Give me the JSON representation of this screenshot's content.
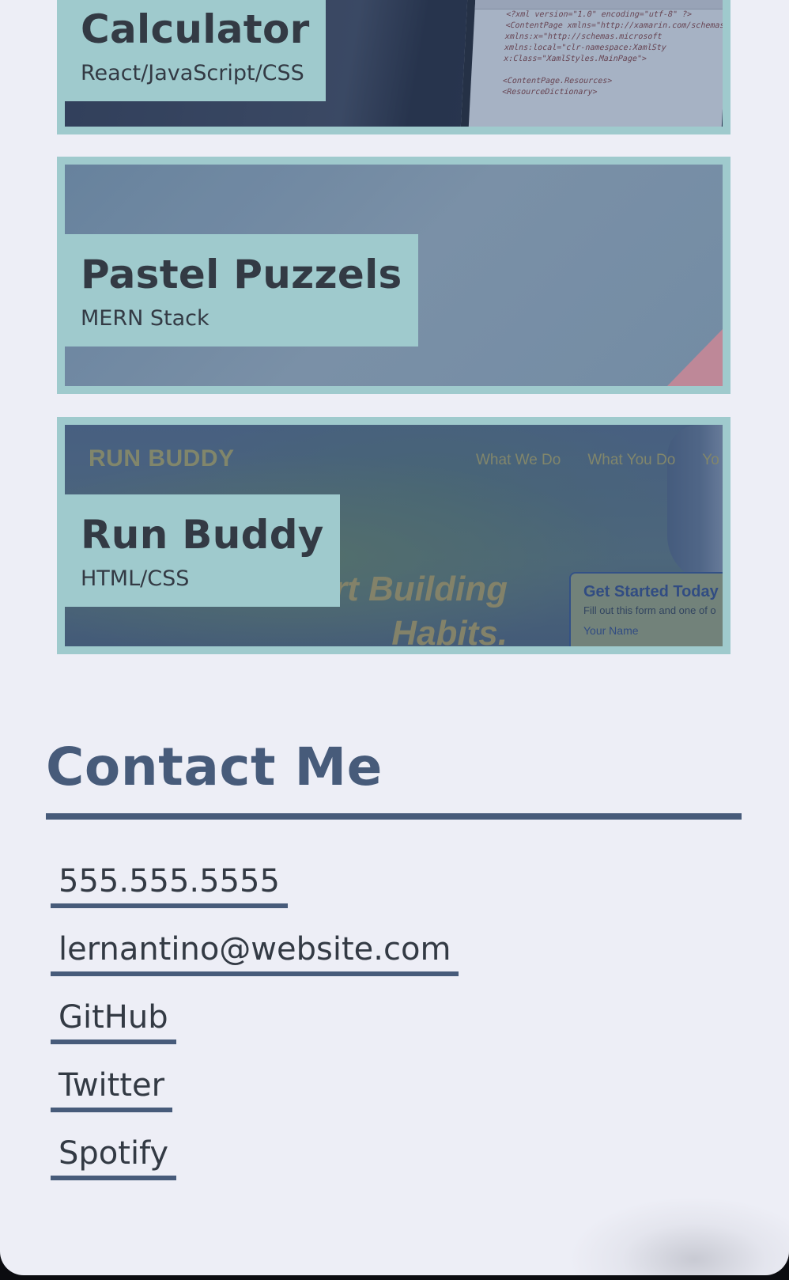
{
  "projects": [
    {
      "title": "Calculator",
      "stack": "React/JavaScript/CSS",
      "preview": {
        "code_lines": [
          "<?xml version=\"1.0\" encoding=\"utf-8\" ?>",
          "<ContentPage xmlns=\"http://xamarin.com/schemas",
          "    xmlns:x=\"http://schemas.microsoft",
          "    xmlns:local=\"clr-namespace:XamlSty",
          "    x:Class=\"XamlStyles.MainPage\">",
          "",
          "  <ContentPage.Resources>",
          "    <ResourceDictionary>"
        ]
      }
    },
    {
      "title": "Pastel Puzzels",
      "stack": "MERN Stack"
    },
    {
      "title": "Run Buddy",
      "stack": "HTML/CSS",
      "preview": {
        "logo": "RUN BUDDY",
        "nav": [
          "What We Do",
          "What You Do",
          "Yo"
        ],
        "hero_line1": "art Building",
        "hero_line2": "Habits.",
        "form_title": "Get Started Today",
        "form_sub": "Fill out this form and one of o",
        "form_label": "Your Name"
      }
    }
  ],
  "contact": {
    "heading": "Contact Me",
    "items": [
      {
        "label": "555.555.5555"
      },
      {
        "label": "lernantino@website.com"
      },
      {
        "label": "GitHub"
      },
      {
        "label": "Twitter"
      },
      {
        "label": "Spotify"
      }
    ]
  },
  "colors": {
    "page_bg": "#edeef6",
    "card_frame": "#9fcacd",
    "heading": "#475b7a",
    "text": "#333a44"
  }
}
